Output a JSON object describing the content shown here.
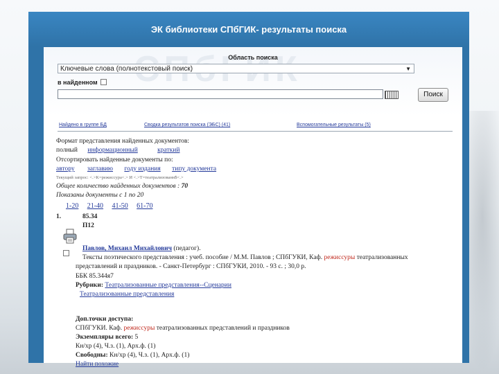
{
  "page_title": "ЭК библиотеки СПбГИК- результаты поиска",
  "watermark": "СПбГИК",
  "search": {
    "area_label": "Область поиска",
    "scope_value": "Ключевые слова (полнотекстовый поиск)",
    "in_found_label": "в найденном",
    "query_value": "",
    "search_button": "Поиск"
  },
  "tabs": [
    "Найдено в группе БД",
    "Сводка результатов поиска (ЭБС) (41)",
    "Вспомогательные результаты (5)"
  ],
  "format": {
    "label": "Формат представления найденных документов:",
    "current": "полный",
    "options": [
      "информационный",
      "краткий"
    ]
  },
  "sort": {
    "label": "Отсортировать найденные документы по:",
    "options": [
      "автору",
      "заглавию",
      "году издания",
      "типу документа"
    ]
  },
  "query_string": "Текущий запрос: <.>K=режиссура<.> И <.>T=театрализованн$<.>",
  "total_label": "Общее количество найденных документов :",
  "total_value": "70",
  "shown_label": "Показаны документы с 1 по 20",
  "pages": [
    "1-20",
    "21-40",
    "41-50",
    "61-70"
  ],
  "record": {
    "number": "1.",
    "code1": "85.34",
    "code2": "П12",
    "author": "Павлов, Михаил Михайлович",
    "author_role": "(педагог).",
    "desc_part1": "Тексты поэтического представления : учеб. пособие / М.М. Павлов ; СПбГУКИ, Каф.",
    "highlight1": "режиссуры",
    "desc_part2": "театрализованных",
    "desc_line2": "представлений и праздников. - Санкт-Петербург : СПбГУКИ, 2010. - 93 с. ; 30,0 р.",
    "bbk": "ББК 85.344я7",
    "rubrics_label": "Рубрики:",
    "rubric1": "Театрализованные представления--Сценарии",
    "rubric2": "Театрализованные представления",
    "access_label": "Доп.точки доступа:",
    "access_part1": "СПбГУКИ. Каф.",
    "highlight2": "режиссуры",
    "access_part2": "театрализованных представлений и праздников",
    "copies_label": "Экземпляры всего:",
    "copies_value": "5",
    "copies_detail": "Кн/хр (4), Ч.з. (1), Арх.ф. (1)",
    "free_label": "Свободны:",
    "free_detail": "Кн/хр (4), Ч.з. (1), Арх.ф. (1)",
    "find_similar": "Найти похожие"
  }
}
